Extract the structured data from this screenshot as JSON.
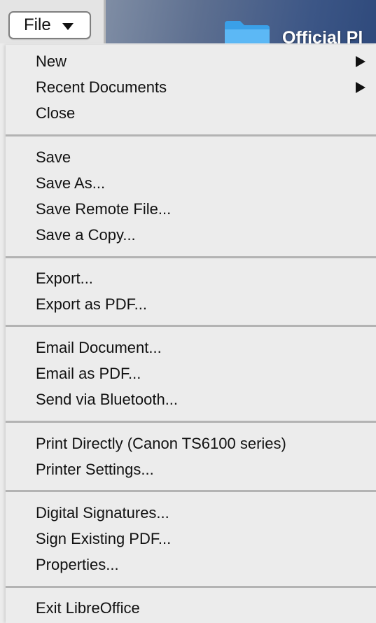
{
  "file_button": {
    "label": "File"
  },
  "desktop": {
    "folder_label": "Official Pl"
  },
  "menu": {
    "groups": [
      {
        "items": [
          {
            "label": "New",
            "has_submenu": true
          },
          {
            "label": "Recent Documents",
            "has_submenu": true
          },
          {
            "label": "Close",
            "has_submenu": false
          }
        ]
      },
      {
        "items": [
          {
            "label": "Save"
          },
          {
            "label": "Save As..."
          },
          {
            "label": "Save Remote File..."
          },
          {
            "label": "Save a Copy..."
          }
        ]
      },
      {
        "items": [
          {
            "label": "Export..."
          },
          {
            "label": "Export as PDF..."
          }
        ]
      },
      {
        "items": [
          {
            "label": "Email Document..."
          },
          {
            "label": "Email as PDF..."
          },
          {
            "label": "Send via Bluetooth..."
          }
        ]
      },
      {
        "items": [
          {
            "label": "Print Directly (Canon TS6100 series)"
          },
          {
            "label": "Printer Settings..."
          }
        ]
      },
      {
        "items": [
          {
            "label": "Digital Signatures..."
          },
          {
            "label": "Sign Existing PDF..."
          },
          {
            "label": "Properties..."
          }
        ]
      },
      {
        "items": [
          {
            "label": "Exit LibreOffice"
          }
        ]
      }
    ]
  }
}
